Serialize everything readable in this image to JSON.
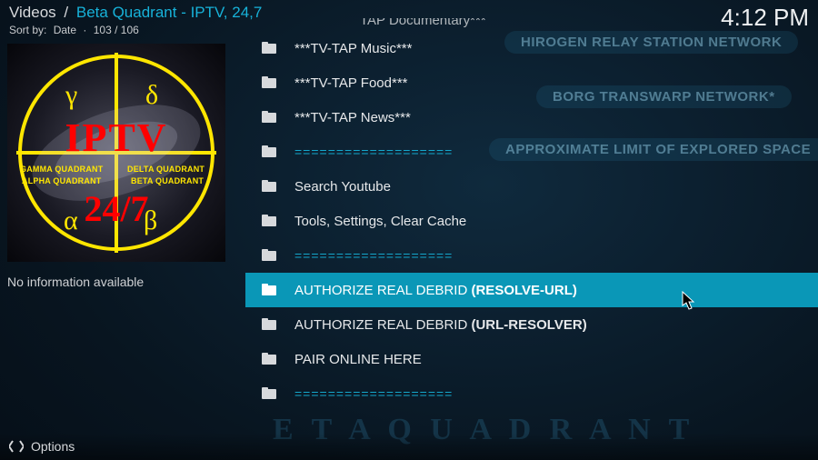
{
  "header": {
    "breadcrumb_root": "Videos",
    "breadcrumb_sep": "/",
    "breadcrumb_leaf": "Beta Quadrant - IPTV, 24,7",
    "clock": "4:12 PM",
    "sort_label": "Sort by:",
    "sort_value": "Date",
    "count": "103 / 106"
  },
  "side": {
    "info_text": "No information available",
    "poster": {
      "line1": "IPTV",
      "line2": "24/7",
      "q_top_left": "GAMMA QUADRANT",
      "q_top_right": "DELTA QUADRANT",
      "q_bot_left": "ALPHA QUADRANT",
      "q_bot_right": "BETA QUADRANT",
      "greek_tl": "γ",
      "greek_tr": "δ",
      "greek_bl": "α",
      "greek_br": "β"
    }
  },
  "list": {
    "partial_top": "TAP Documentary***",
    "items": [
      {
        "label_plain": "***TV-TAP Music***",
        "type": "item"
      },
      {
        "label_plain": "***TV-TAP Food***",
        "type": "item"
      },
      {
        "label_plain": "***TV-TAP News***",
        "type": "item"
      },
      {
        "label_plain": "===================",
        "type": "sep"
      },
      {
        "label_plain": "Search Youtube",
        "type": "item"
      },
      {
        "label_plain": "Tools, Settings, Clear Cache",
        "type": "item"
      },
      {
        "label_plain": "===================",
        "type": "sep"
      },
      {
        "label_pre": "AUTHORIZE REAL DEBRID ",
        "label_bold": "(RESOLVE-URL)",
        "type": "item",
        "selected": true
      },
      {
        "label_pre": "AUTHORIZE REAL DEBRID ",
        "label_bold": "(URL-RESOLVER)",
        "type": "item"
      },
      {
        "label_plain": "PAIR ONLINE HERE",
        "type": "item"
      },
      {
        "label_plain": "===================",
        "type": "sep"
      }
    ]
  },
  "bg": {
    "l1": "HIROGEN RELAY STATION NETWORK",
    "l2": "BORG TRANSWARP NETWORK*",
    "l3": "APPROXIMATE LIMIT OF EXPLORED SPACE",
    "big": "E T A   Q U A D R A N T"
  },
  "footer": {
    "options": "Options"
  }
}
